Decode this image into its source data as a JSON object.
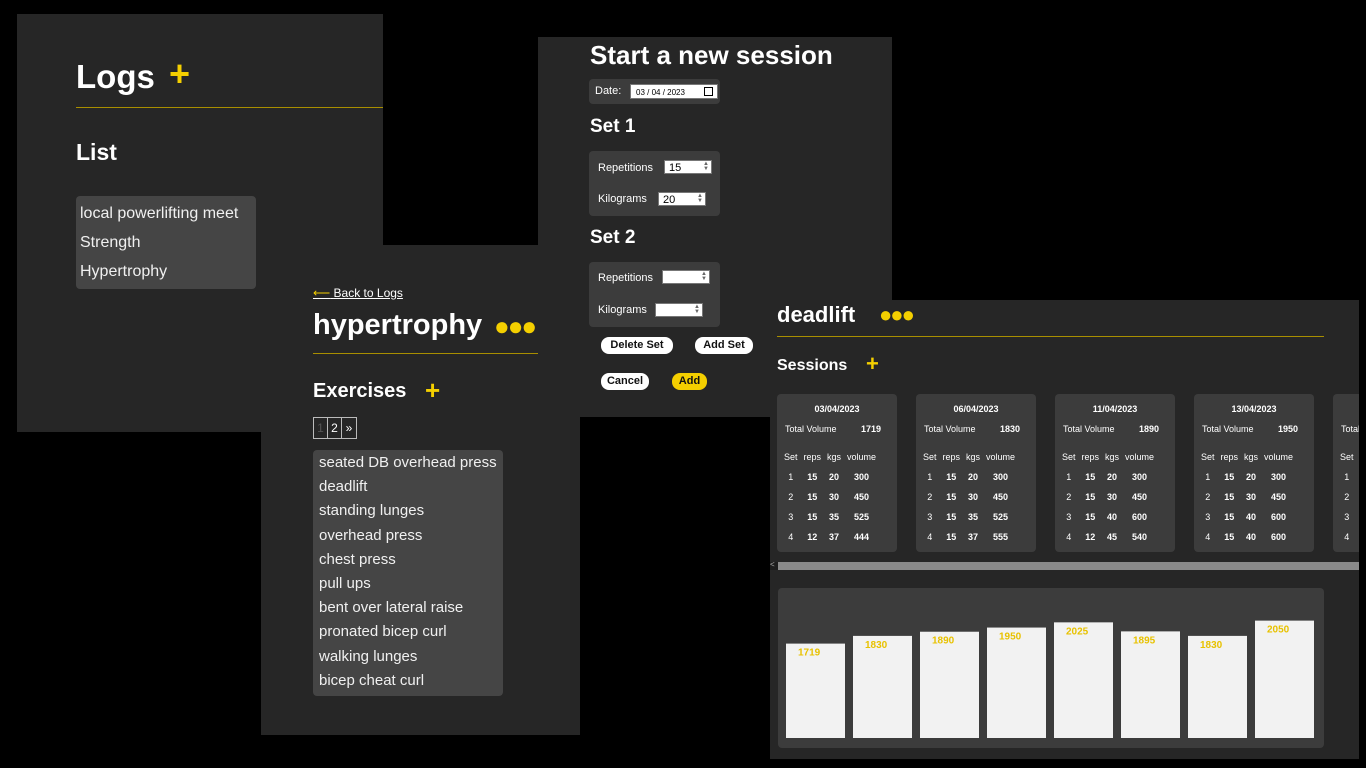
{
  "logs_panel": {
    "title": "Logs",
    "add_icon": "plus-icon",
    "subtitle": "List",
    "items": [
      "local powerlifting meet",
      "Strength",
      "Hypertrophy"
    ]
  },
  "hypertrophy_panel": {
    "back_link": "Back to Logs",
    "back_arrow": "⟵",
    "title": "hypertrophy",
    "menu_icon": "more-dots-icon",
    "exercises_title": "Exercises",
    "pager": [
      "1",
      "2",
      "»"
    ],
    "exercises": [
      "seated DB overhead press",
      "deadlift",
      "standing lunges",
      "overhead press",
      "chest press",
      "pull ups",
      "bent over lateral raise",
      "pronated bicep curl",
      "walking lunges",
      "bicep cheat curl"
    ]
  },
  "session_panel": {
    "title": "Start a new session",
    "date_label": "Date:",
    "date_value": "03 / 04 / 2023",
    "set1": {
      "heading": "Set 1",
      "reps_label": "Repetitions",
      "reps_value": "15",
      "kg_label": "Kilograms",
      "kg_value": "20"
    },
    "set2": {
      "heading": "Set 2",
      "reps_label": "Repetitions",
      "reps_value": "",
      "kg_label": "Kilograms",
      "kg_value": ""
    },
    "delete_set": "Delete Set",
    "add_set": "Add Set",
    "cancel": "Cancel",
    "add": "Add"
  },
  "deadlift_panel": {
    "title": "deadlift",
    "menu_icon": "more-dots-icon",
    "sessions_title": "Sessions",
    "total_volume_label": "Total Volume",
    "columns": [
      "Set",
      "reps",
      "kgs",
      "volume"
    ],
    "sessions": [
      {
        "date": "03/04/2023",
        "total": "1719",
        "rows": [
          [
            "1",
            "15",
            "20",
            "300"
          ],
          [
            "2",
            "15",
            "30",
            "450"
          ],
          [
            "3",
            "15",
            "35",
            "525"
          ],
          [
            "4",
            "12",
            "37",
            "444"
          ]
        ]
      },
      {
        "date": "06/04/2023",
        "total": "1830",
        "rows": [
          [
            "1",
            "15",
            "20",
            "300"
          ],
          [
            "2",
            "15",
            "30",
            "450"
          ],
          [
            "3",
            "15",
            "35",
            "525"
          ],
          [
            "4",
            "15",
            "37",
            "555"
          ]
        ]
      },
      {
        "date": "11/04/2023",
        "total": "1890",
        "rows": [
          [
            "1",
            "15",
            "20",
            "300"
          ],
          [
            "2",
            "15",
            "30",
            "450"
          ],
          [
            "3",
            "15",
            "40",
            "600"
          ],
          [
            "4",
            "12",
            "45",
            "540"
          ]
        ]
      },
      {
        "date": "13/04/2023",
        "total": "1950",
        "rows": [
          [
            "1",
            "15",
            "20",
            "300"
          ],
          [
            "2",
            "15",
            "30",
            "450"
          ],
          [
            "3",
            "15",
            "40",
            "600"
          ],
          [
            "4",
            "15",
            "40",
            "600"
          ]
        ]
      },
      {
        "date": "",
        "total": "",
        "rows": [
          [
            "1",
            "",
            "",
            ""
          ],
          [
            "2",
            "",
            "",
            ""
          ],
          [
            "3",
            "",
            "",
            ""
          ],
          [
            "4",
            "",
            "",
            ""
          ]
        ]
      }
    ]
  },
  "chart_data": {
    "type": "bar",
    "values": [
      1719,
      1830,
      1890,
      1950,
      2025,
      1895,
      1830,
      2050
    ],
    "bar_color": "#f2f2f2",
    "label_color": "#e8c200"
  },
  "colors": {
    "accent": "#f4cf00",
    "panel": "#262626",
    "card": "#3c3c3c"
  }
}
